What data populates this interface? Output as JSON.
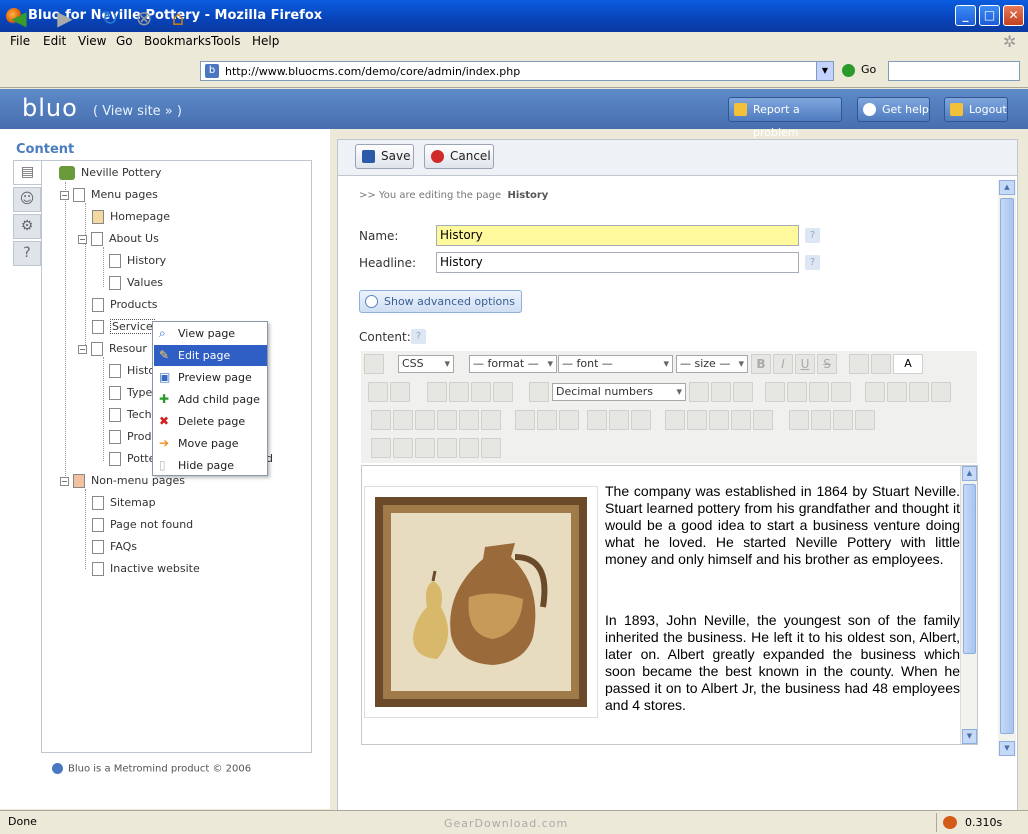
{
  "browser": {
    "title": "Bluo for Neville Pottery - Mozilla Firefox",
    "menus": [
      "File",
      "Edit",
      "View",
      "Go",
      "Bookmarks",
      "Tools",
      "Help"
    ],
    "url": "http://www.bluocms.com/demo/core/admin/index.php",
    "go_label": "Go",
    "status": "Done",
    "load_time": "0.310s"
  },
  "header": {
    "logo": "bluo",
    "view_site": "( View site » )",
    "report": "Report a problem",
    "help": "Get help",
    "logout": "Logout"
  },
  "sidebar": {
    "title": "Content",
    "tree": {
      "root": "Neville Pottery",
      "menu_pages": "Menu pages",
      "homepage": "Homepage",
      "about": "About Us",
      "history": "History",
      "values": "Values",
      "products": "Products",
      "services": "Service",
      "resources": "Resour",
      "r1": "Histo",
      "r2": "Type",
      "r3": "Tech",
      "r4": "Prod",
      "r5": "Potte",
      "r5_tail": "d",
      "non_menu": "Non-menu pages",
      "sitemap": "Sitemap",
      "notfound": "Page not found",
      "faqs": "FAQs",
      "inactive": "Inactive website"
    },
    "footer": "Bluo is a Metromind product © 2006"
  },
  "context_menu": {
    "items": [
      "View page",
      "Edit page",
      "Preview page",
      "Add child page",
      "Delete page",
      "Move page",
      "Hide page"
    ],
    "selected_index": 1
  },
  "editor": {
    "save": "Save",
    "cancel": "Cancel",
    "breadcrumb_prefix": ">> You are editing the page",
    "breadcrumb_page": "History",
    "name_label": "Name:",
    "name_value": "History",
    "headline_label": "Headline:",
    "headline_value": "History",
    "advanced": "Show advanced options",
    "content_label": "Content:",
    "toolbar": {
      "css": "CSS",
      "format": "— format —",
      "font": "— font —",
      "size": "— size —",
      "list": "Decimal numbers",
      "bold": "B",
      "italic": "I",
      "underline": "U",
      "strike": "S",
      "a_box": "A"
    },
    "para1": "The company was established in 1864 by Stuart Neville. Stuart learned pottery from his grandfather and thought it would be a good idea to start a business venture doing what he loved. He started Neville Pottery with little money and only himself and his brother as employees.",
    "para2": "In 1893, John Neville, the youngest son of the family inherited the business. He left it to his oldest son, Albert, later on. Albert greatly expanded the business which soon became the best known in the county. When he passed it on to Albert Jr, the business had 48 employees and 4 stores."
  },
  "watermark": "GearDownload.com"
}
